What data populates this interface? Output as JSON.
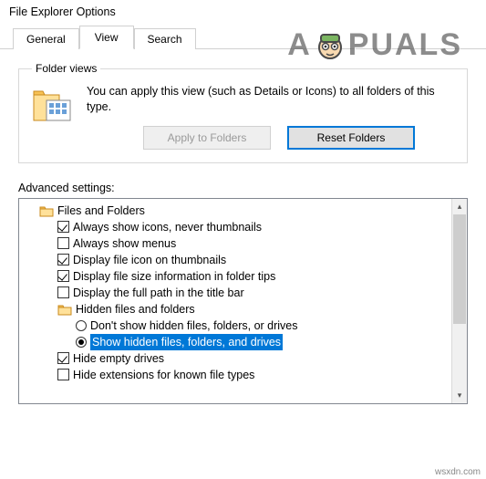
{
  "window": {
    "title": "File Explorer Options"
  },
  "tabs": {
    "general": "General",
    "view": "View",
    "search": "Search",
    "active": "view"
  },
  "folderViews": {
    "legend": "Folder views",
    "text": "You can apply this view (such as Details or Icons) to all folders of this type.",
    "applyBtn": "Apply to Folders",
    "resetBtn": "Reset Folders"
  },
  "advanced": {
    "label": "Advanced settings:"
  },
  "tree": {
    "root": "Files and Folders",
    "items": [
      {
        "type": "check",
        "checked": true,
        "label": "Always show icons, never thumbnails"
      },
      {
        "type": "check",
        "checked": false,
        "label": "Always show menus"
      },
      {
        "type": "check",
        "checked": true,
        "label": "Display file icon on thumbnails"
      },
      {
        "type": "check",
        "checked": true,
        "label": "Display file size information in folder tips"
      },
      {
        "type": "check",
        "checked": false,
        "label": "Display the full path in the title bar"
      },
      {
        "type": "group",
        "label": "Hidden files and folders",
        "children": [
          {
            "type": "radio",
            "selected": false,
            "label": "Don't show hidden files, folders, or drives"
          },
          {
            "type": "radio",
            "selected": true,
            "label": "Show hidden files, folders, and drives"
          }
        ]
      },
      {
        "type": "check",
        "checked": true,
        "label": "Hide empty drives"
      },
      {
        "type": "check",
        "checked": false,
        "label": "Hide extensions for known file types"
      }
    ]
  },
  "watermark": {
    "a": "A",
    "puals": "PUALS"
  },
  "source": "wsxdn.com"
}
